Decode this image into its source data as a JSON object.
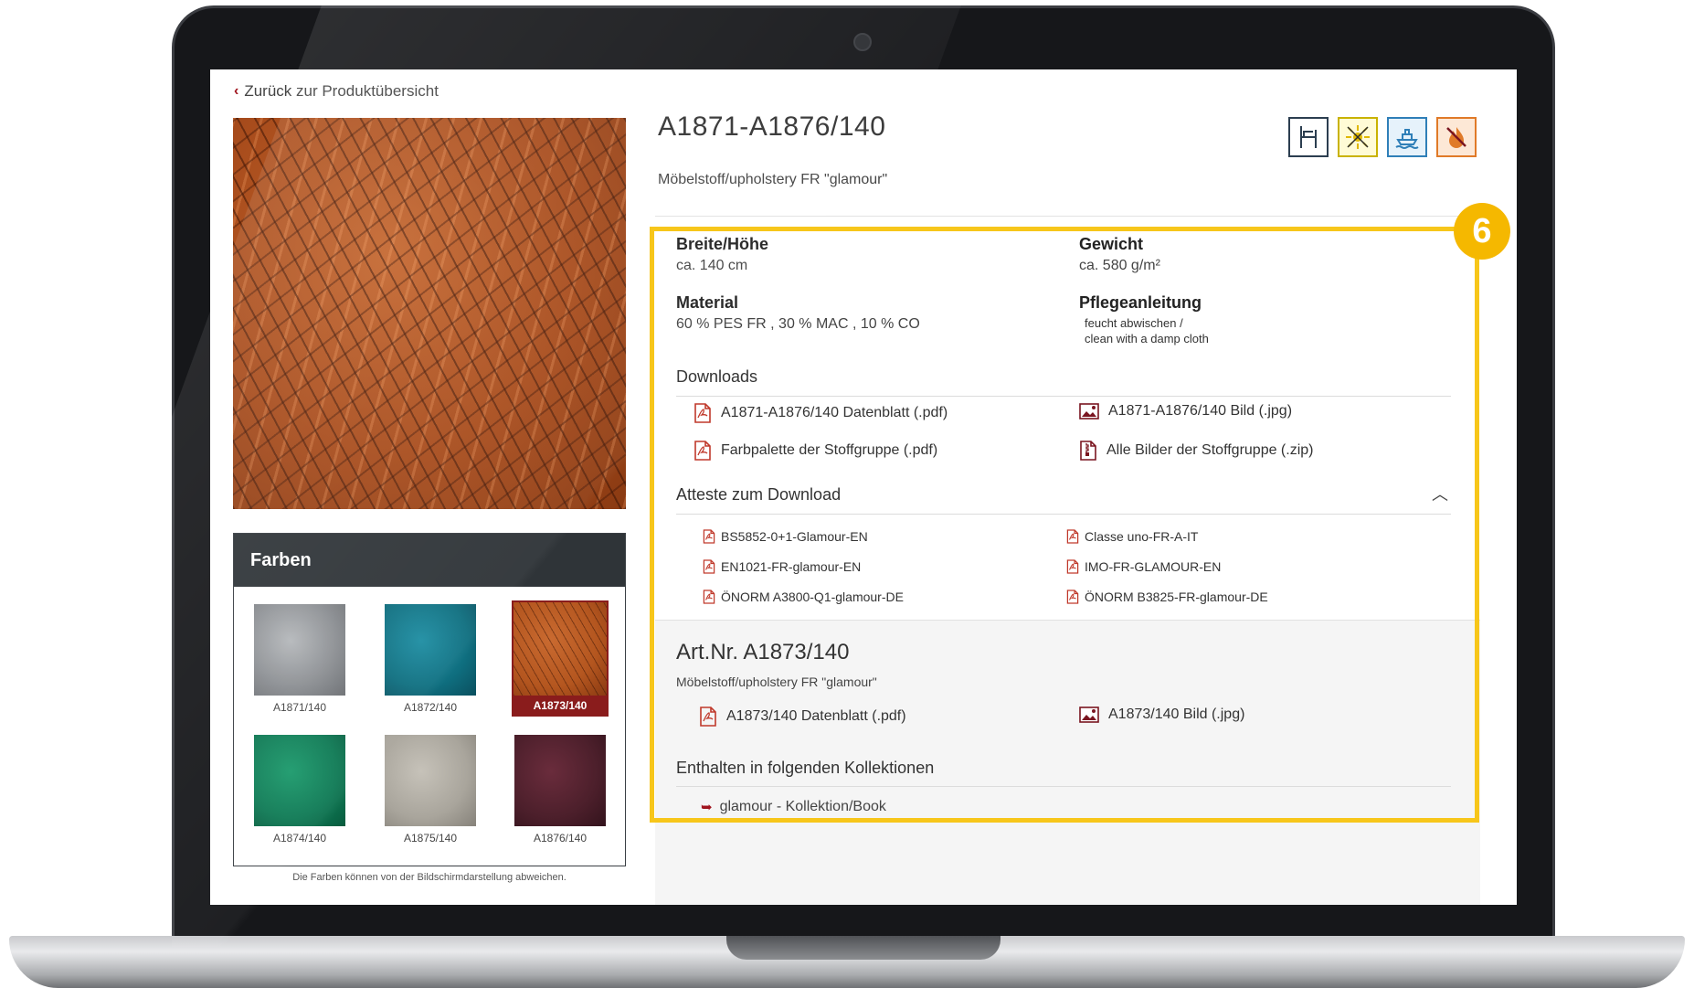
{
  "nav": {
    "back_label": "Zurück zur Produktübersicht"
  },
  "product": {
    "title": "A1871-A1876/140",
    "subtitle": "Möbelstoff/upholstery FR \"glamour\""
  },
  "feature_icons": [
    {
      "name": "upholstery-chair-icon",
      "color": "#2c3e50"
    },
    {
      "name": "lightfastness-sun-icon",
      "color": "#c9b200"
    },
    {
      "name": "marine-ship-icon",
      "color": "#2f7fb8"
    },
    {
      "name": "flame-retardant-icon",
      "color": "#e07a28"
    }
  ],
  "farben": {
    "title": "Farben",
    "swatches": [
      {
        "label": "A1871/140",
        "color": "#8e9195",
        "active": false
      },
      {
        "label": "A1872/140",
        "color": "#0f6f80",
        "active": false
      },
      {
        "label": "A1873/140",
        "color": "#b4561f",
        "active": true
      },
      {
        "label": "A1874/140",
        "color": "#0f7a55",
        "active": false
      },
      {
        "label": "A1875/140",
        "color": "#a9a59c",
        "active": false
      },
      {
        "label": "A1876/140",
        "color": "#4c1f2b",
        "active": false
      }
    ],
    "disclaimer": "Die Farben können von der Bildschirmdarstellung abweichen."
  },
  "specs": {
    "breite_label": "Breite/Höhe",
    "breite_value": "ca. 140 cm",
    "gewicht_label": "Gewicht",
    "gewicht_value": "ca. 580 g/m²",
    "material_label": "Material",
    "material_value": "60 % PES FR , 30 % MAC , 10 % CO",
    "pflege_label": "Pflegeanleitung",
    "pflege_line1": "feucht abwischen /",
    "pflege_line2": "clean with a damp cloth"
  },
  "downloads": {
    "title": "Downloads",
    "items": [
      {
        "label": "A1871-A1876/140 Datenblatt (.pdf)",
        "icon": "pdf-icon"
      },
      {
        "label": "A1871-A1876/140 Bild (.jpg)",
        "icon": "image-icon"
      },
      {
        "label": "Farbpalette der Stoffgruppe (.pdf)",
        "icon": "pdf-icon"
      },
      {
        "label": "Alle Bilder der Stoffgruppe (.zip)",
        "icon": "zip-icon"
      }
    ]
  },
  "atteste": {
    "title": "Atteste zum Download",
    "items": [
      "BS5852-0+1-Glamour-EN",
      "Classe uno-FR-A-IT",
      "EN1021-FR-glamour-EN",
      "IMO-FR-GLAMOUR-EN",
      "ÖNORM A3800-Q1-glamour-DE",
      "ÖNORM B3825-FR-glamour-DE"
    ]
  },
  "article": {
    "title": "Art.Nr. A1873/140",
    "subtitle": "Möbelstoff/upholstery FR \"glamour\"",
    "datasheet": "A1873/140 Datenblatt (.pdf)",
    "image": "A1873/140 Bild (.jpg)"
  },
  "collections": {
    "title": "Enthalten in folgenden Kollektionen",
    "link": "glamour - Kollektion/Book"
  },
  "callout": {
    "number": "6",
    "color": "#f7c61a"
  }
}
